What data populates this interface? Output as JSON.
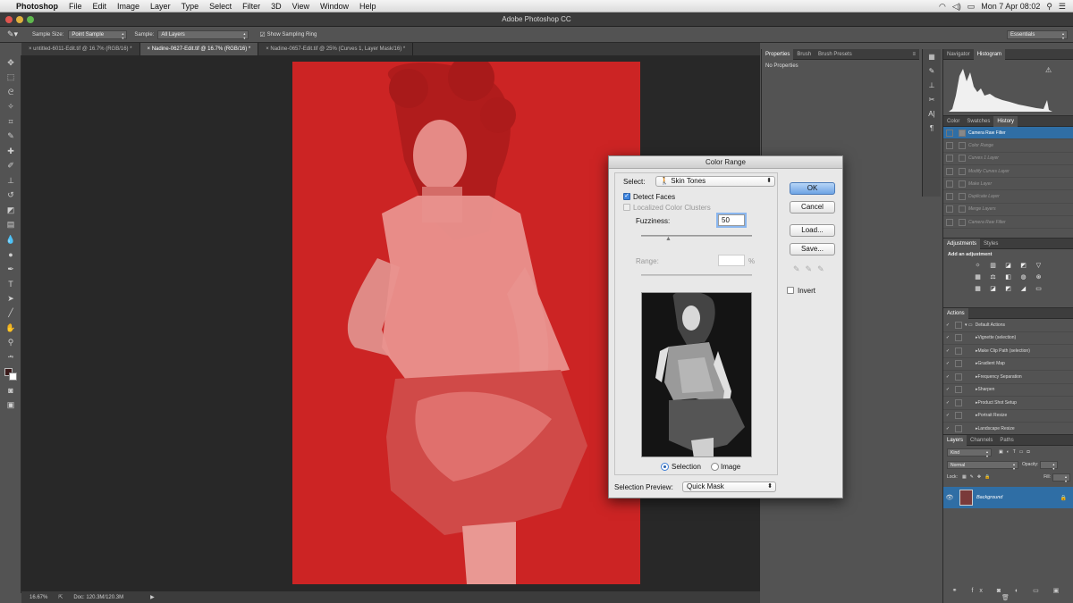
{
  "menubar": {
    "apple": "",
    "app": "Photoshop",
    "items": [
      "File",
      "Edit",
      "Image",
      "Layer",
      "Type",
      "Select",
      "Filter",
      "3D",
      "View",
      "Window",
      "Help"
    ],
    "clock": "Mon 7 Apr  08:02"
  },
  "window_title": "Adobe Photoshop CC",
  "options": {
    "sample_size_label": "Sample Size:",
    "sample_size_value": "Point Sample",
    "sample_label": "Sample:",
    "sample_value": "All Layers",
    "show_ring": "Show Sampling Ring",
    "workspace": "Essentials"
  },
  "tabs": [
    {
      "label": "untitled-6011-Edit.tif @ 16.7% (RGB/16) *"
    },
    {
      "label": "Nadine-0627-Edit.tif @ 16.7% (RGB/16) *"
    },
    {
      "label": "Nadine-0657-Edit.tif @ 25% (Curves 1, Layer Mask/16) *"
    }
  ],
  "status": {
    "zoom": "16.67%",
    "doc": "Doc: 120.3M/120.3M"
  },
  "properties": {
    "tabs": [
      "Properties",
      "Brush",
      "Brush Presets"
    ],
    "body": "No Properties"
  },
  "navigator": {
    "tabs": [
      "Navigator",
      "Histogram"
    ]
  },
  "history": {
    "tabs": [
      "Color",
      "Swatches",
      "History"
    ],
    "items": [
      "Camera Raw Filter",
      "Color Range",
      "Curves 1 Layer",
      "Modify Curves Layer",
      "Make Layer",
      "Duplicate Layer",
      "Merge Layers",
      "Camera Raw Filter"
    ]
  },
  "adjustments": {
    "tabs": [
      "Adjustments",
      "Styles"
    ],
    "heading": "Add an adjustment"
  },
  "actions": {
    "tab": "Actions",
    "set": "Default Actions",
    "items": [
      "Vignette (selection)",
      "Make Clip Path (selection)",
      "Gradient Map",
      "Frequency Separation",
      "Sharpen",
      "Product Shot Setup",
      "Portrait Resize",
      "Landscape Resize"
    ]
  },
  "layers": {
    "tabs": [
      "Layers",
      "Channels",
      "Paths"
    ],
    "filter": "Kind",
    "blend": "Normal",
    "opacity_label": "Opacity:",
    "lock_label": "Lock:",
    "fill_label": "Fill:",
    "layer_name": "Background"
  },
  "dialog": {
    "title": "Color Range",
    "select_label": "Select:",
    "select_value": "Skin Tones",
    "detect_faces": "Detect Faces",
    "localized": "Localized Color Clusters",
    "fuzziness_label": "Fuzziness:",
    "fuzziness_value": "50",
    "range_label": "Range:",
    "range_unit": "%",
    "radio_selection": "Selection",
    "radio_image": "Image",
    "preview_label": "Selection Preview:",
    "preview_value": "Quick Mask",
    "ok": "OK",
    "cancel": "Cancel",
    "load": "Load...",
    "save": "Save...",
    "invert": "Invert"
  },
  "colors": {
    "mask_red": "#cc2424",
    "highlight": "#2f6ea5"
  }
}
